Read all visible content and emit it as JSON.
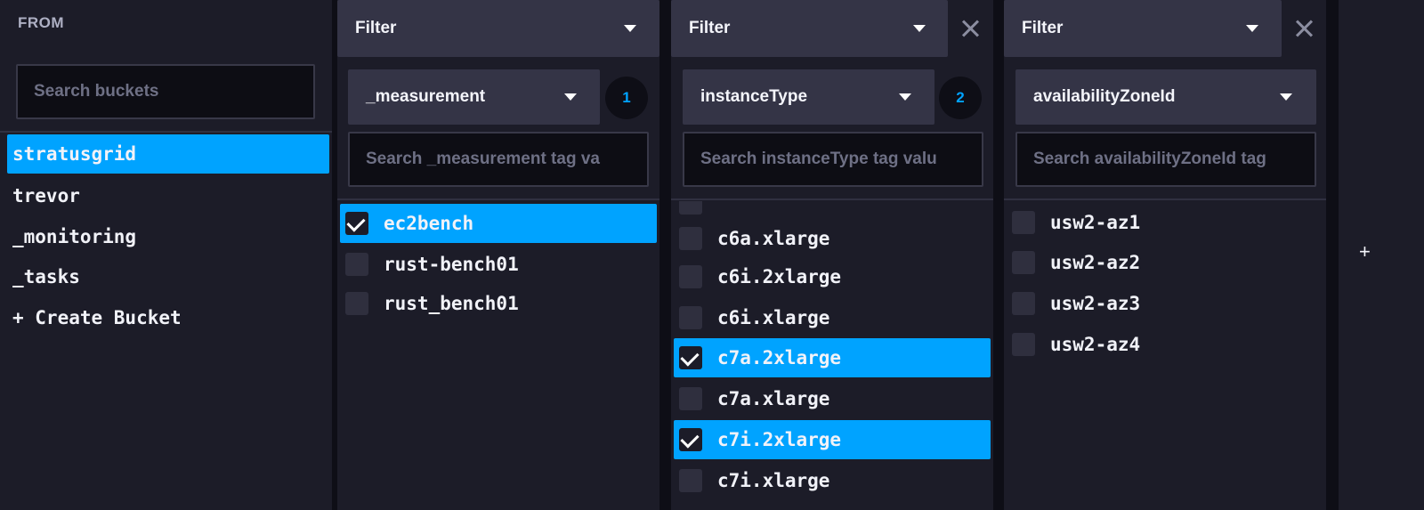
{
  "from": {
    "header": "FROM",
    "search_placeholder": "Search buckets",
    "buckets": [
      "stratusgrid",
      "trevor",
      "_monitoring",
      "_tasks",
      "+ Create Bucket"
    ],
    "selected": "stratusgrid"
  },
  "filters": [
    {
      "header": "Filter",
      "key": "_measurement",
      "badge": "1",
      "search_placeholder": "Search _measurement tag va",
      "values": [
        {
          "label": "ec2bench",
          "checked": true
        },
        {
          "label": "rust-bench01",
          "checked": false
        },
        {
          "label": "rust_bench01",
          "checked": false
        }
      ]
    },
    {
      "header": "Filter",
      "key": "instanceType",
      "badge": "2",
      "search_placeholder": "Search instanceType tag valu",
      "values": [
        {
          "label": "c6a.xlarge",
          "checked": false
        },
        {
          "label": "c6i.2xlarge",
          "checked": false
        },
        {
          "label": "c6i.xlarge",
          "checked": false
        },
        {
          "label": "c7a.2xlarge",
          "checked": true
        },
        {
          "label": "c7a.xlarge",
          "checked": false
        },
        {
          "label": "c7i.2xlarge",
          "checked": true
        },
        {
          "label": "c7i.xlarge",
          "checked": false
        }
      ]
    },
    {
      "header": "Filter",
      "key": "availabilityZoneId",
      "search_placeholder": "Search availabilityZoneId tag",
      "values": [
        {
          "label": "usw2-az1",
          "checked": false
        },
        {
          "label": "usw2-az2",
          "checked": false
        },
        {
          "label": "usw2-az3",
          "checked": false
        },
        {
          "label": "usw2-az4",
          "checked": false
        }
      ]
    }
  ],
  "add_filter_label": "+",
  "colors": {
    "accent": "#00a3ff",
    "panel": "#1c1c28",
    "header": "#343446"
  }
}
